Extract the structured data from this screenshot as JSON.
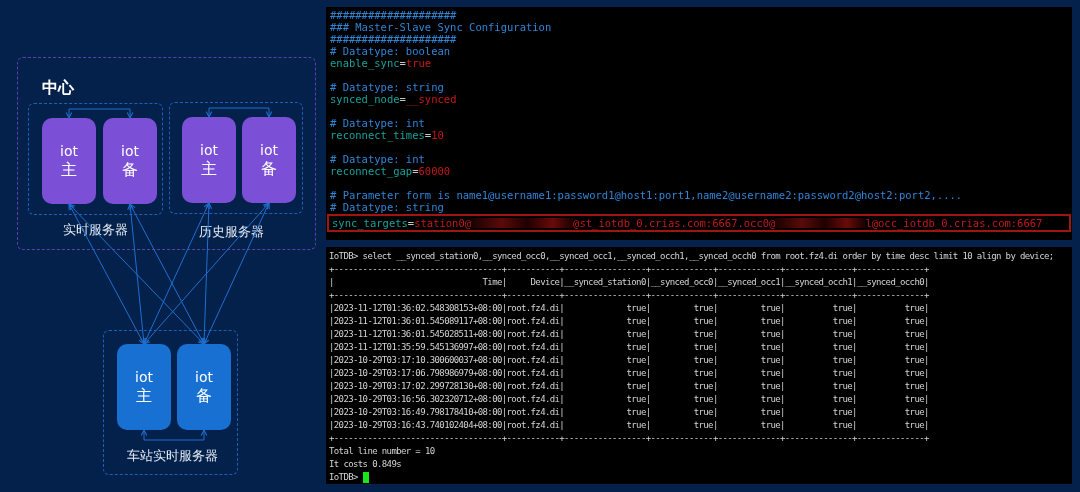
{
  "diagram": {
    "title": "中心",
    "groups": [
      {
        "kind": "center",
        "label": "实时服务器",
        "nodes": [
          {
            "name": "iot",
            "role": "主"
          },
          {
            "name": "iot",
            "role": "备"
          }
        ]
      },
      {
        "kind": "center",
        "label": "历史服务器",
        "nodes": [
          {
            "name": "iot",
            "role": "主"
          },
          {
            "name": "iot",
            "role": "备"
          }
        ]
      },
      {
        "kind": "station",
        "label": "车站实时服务器",
        "nodes": [
          {
            "name": "iot",
            "role": "主"
          },
          {
            "name": "iot",
            "role": "备"
          }
        ]
      }
    ]
  },
  "config_terminal": {
    "lines": [
      {
        "kind": "comment",
        "text": "####################"
      },
      {
        "kind": "comment",
        "text": "### Master-Slave Sync Configuration"
      },
      {
        "kind": "comment",
        "text": "####################"
      },
      {
        "kind": "comment",
        "text": "# Datatype: boolean"
      },
      {
        "kind": "setting",
        "key": "enable_sync",
        "sep": "=",
        "value": "true"
      },
      {
        "kind": "blank"
      },
      {
        "kind": "comment",
        "text": "# Datatype: string"
      },
      {
        "kind": "setting",
        "key": "synced_node",
        "sep": "=",
        "value": "__synced"
      },
      {
        "kind": "blank"
      },
      {
        "kind": "comment",
        "text": "# Datatype: int"
      },
      {
        "kind": "setting",
        "key": "reconnect_times",
        "sep": "=",
        "value": "10"
      },
      {
        "kind": "blank"
      },
      {
        "kind": "comment",
        "text": "# Datatype: int"
      },
      {
        "kind": "setting",
        "key": "reconnect_gap",
        "sep": "=",
        "value": "60000"
      },
      {
        "kind": "blank"
      },
      {
        "kind": "comment",
        "text": "# Parameter form is name1@username1:password1@host1:port1,name2@username2:password2@host2:port2,...."
      },
      {
        "kind": "comment",
        "text": "# Datatype: string"
      },
      {
        "kind": "targets",
        "key": "sync_targets",
        "sep": "=",
        "highlighted": true,
        "parts": [
          {
            "kind": "text",
            "text": "station0@"
          },
          {
            "kind": "redacted"
          },
          {
            "kind": "text",
            "text": "@st_iotdb_0.crias.com:6667.occ0@"
          },
          {
            "kind": "redacted"
          },
          {
            "kind": "text",
            "text": "l@occ_iotdb_0.crias.com:6667"
          }
        ]
      }
    ]
  },
  "query_terminal": {
    "lines": [
      {
        "kind": "text",
        "text": "IoTDB> select __synced_station0,__synced_occ0,__synced_occ1,__synced_occh1,__synced_occh0 from root.fz4.di order by time desc limit 10 align by device;"
      },
      {
        "kind": "text",
        "text": "+-----------------------------------+-----------+-----------------+-------------+-------------+--------------+--------------+"
      },
      {
        "kind": "text",
        "text": "|                               Time|     Device|__synced_station0|__synced_occ0|__synced_occ1|__synced_occh1|__synced_occh0|"
      },
      {
        "kind": "text",
        "text": "+-----------------------------------+-----------+-----------------+-------------+-------------+--------------+--------------+"
      },
      {
        "kind": "text",
        "text": "|2023-11-12T01:36:02.548308153+08:00|root.fz4.di|             true|         true|         true|          true|          true|"
      },
      {
        "kind": "text",
        "text": "|2023-11-12T01:36:01.545089117+08:00|root.fz4.di|             true|         true|         true|          true|          true|"
      },
      {
        "kind": "text",
        "text": "|2023-11-12T01:36:01.545028511+08:00|root.fz4.di|             true|         true|         true|          true|          true|"
      },
      {
        "kind": "text",
        "text": "|2023-11-12T01:35:59.545136997+08:00|root.fz4.di|             true|         true|         true|          true|          true|"
      },
      {
        "kind": "text",
        "text": "|2023-10-29T03:17:10.300600037+08:00|root.fz4.di|             true|         true|         true|          true|          true|"
      },
      {
        "kind": "text",
        "text": "|2023-10-29T03:17:06.798986979+08:00|root.fz4.di|             true|         true|         true|          true|          true|"
      },
      {
        "kind": "text",
        "text": "|2023-10-29T03:17:02.299728130+08:00|root.fz4.di|             true|         true|         true|          true|          true|"
      },
      {
        "kind": "text",
        "text": "|2023-10-29T03:16:56.302320712+08:00|root.fz4.di|             true|         true|         true|          true|          true|"
      },
      {
        "kind": "text",
        "text": "|2023-10-29T03:16:49.798178410+08:00|root.fz4.di|             true|         true|         true|          true|          true|"
      },
      {
        "kind": "text",
        "text": "|2023-10-29T03:16:43.740102404+08:00|root.fz4.di|             true|         true|         true|          true|          true|"
      },
      {
        "kind": "text",
        "text": "+-----------------------------------+-----------+-----------------+-------------+-------------+--------------+--------------+"
      },
      {
        "kind": "text",
        "text": "Total line number = 10"
      },
      {
        "kind": "text",
        "text": "It costs 0.849s"
      },
      {
        "kind": "prompt",
        "text": "IoTDB>"
      }
    ]
  }
}
